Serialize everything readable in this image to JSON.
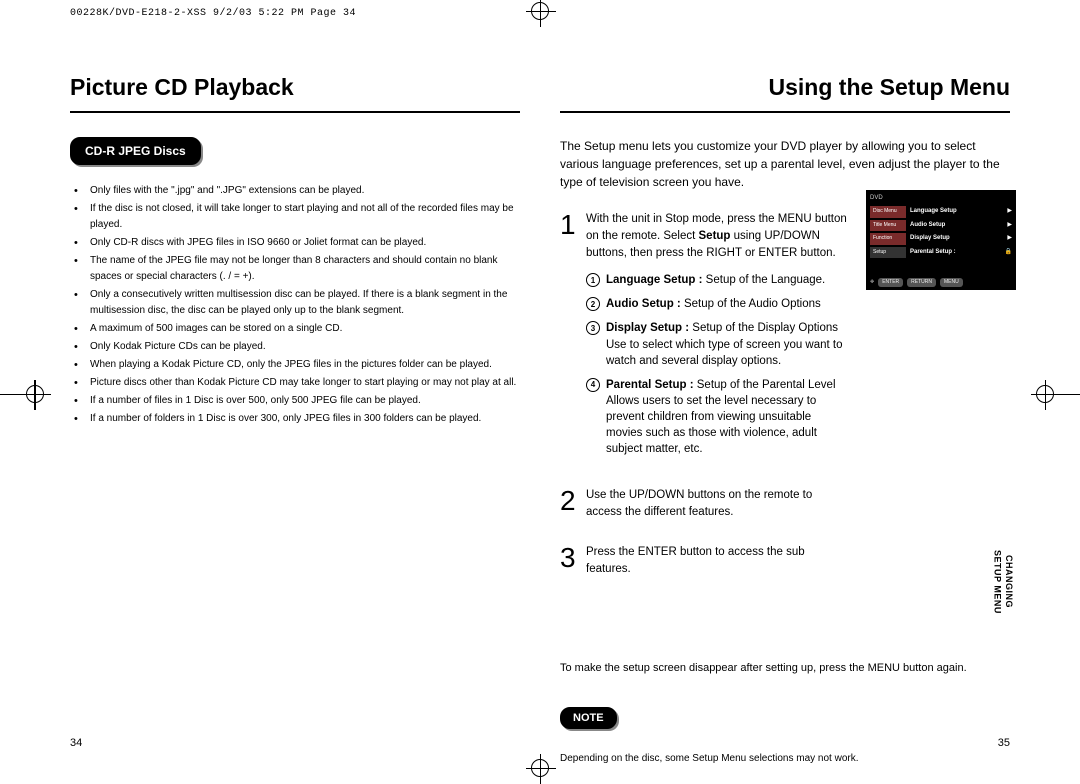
{
  "header_line": "00228K/DVD-E218-2-XSS  9/2/03 5:22 PM  Page 34",
  "left": {
    "title": "Picture CD Playback",
    "pill": "CD-R JPEG Discs",
    "bullets": [
      "Only files with the \".jpg\" and \".JPG\" extensions can be played.",
      "If the disc is not closed, it will take longer to start playing and not all of the recorded files may be played.",
      "Only CD-R discs with JPEG files in ISO 9660 or Joliet format can be played.",
      "The name of the JPEG file may not be longer than 8 characters and should contain no blank spaces or special characters (. / = +).",
      "Only a consecutively written multisession disc can be played. If there is a blank segment in the multisession disc, the disc can be played only up to the blank segment.",
      "A maximum of 500 images can be stored on a single CD.",
      "Only Kodak Picture CDs can be played.",
      "When playing a Kodak Picture CD, only the JPEG files in the pictures folder can be played.",
      "Picture discs other than Kodak Picture CD may take longer to start playing or may not play at all.",
      "If a number of files in 1 Disc is over 500, only 500 JPEG file can be played.",
      "If a number of folders in 1 Disc is over 300, only JPEG files in 300 folders can be played."
    ],
    "page_num": "34"
  },
  "right": {
    "title": "Using the Setup Menu",
    "intro": "The Setup menu lets you customize your DVD player by allowing you to select various language preferences, set up a parental level, even adjust the player to the type of television screen you have.",
    "steps": [
      {
        "num": "1",
        "body_prefix": "With the unit in Stop mode, press the MENU button on the remote. Select ",
        "body_bold": "Setup",
        "body_suffix": " using UP/DOWN buttons, then press the RIGHT or ENTER button.",
        "sub": [
          {
            "n": "1",
            "b": "Language Setup :",
            "t": " Setup of the Language."
          },
          {
            "n": "2",
            "b": "Audio Setup :",
            "t": " Setup of the Audio Options"
          },
          {
            "n": "3",
            "b": "Display Setup :",
            "t": " Setup of the Display Options Use to select which type of screen you want to watch and several display options."
          },
          {
            "n": "4",
            "b": "Parental Setup :",
            "t": " Setup of the Parental Level Allows users to set the level necessary to prevent children from viewing unsuitable movies such as those with violence, adult subject matter, etc."
          }
        ]
      },
      {
        "num": "2",
        "plain": "Use the UP/DOWN buttons on the remote to access the different features."
      },
      {
        "num": "3",
        "plain": "Press the ENTER button to access the sub features."
      }
    ],
    "closing": "To make the setup screen disappear after setting up, press the MENU button again.",
    "note_label": "NOTE",
    "note_text": "Depending on the disc, some Setup Menu selections may not work.",
    "dvd": {
      "label": "DVD",
      "side": [
        "Disc Menu",
        "Title Menu",
        "Function",
        "Setup"
      ],
      "opts": [
        "Language Setup",
        "Audio Setup",
        "Display Setup",
        "Parental Setup :"
      ],
      "bottom": [
        "ENTER",
        "RETURN",
        "MENU"
      ]
    },
    "vtab_l1": "CHANGING",
    "vtab_l2": "SETUP MENU",
    "page_num": "35"
  }
}
